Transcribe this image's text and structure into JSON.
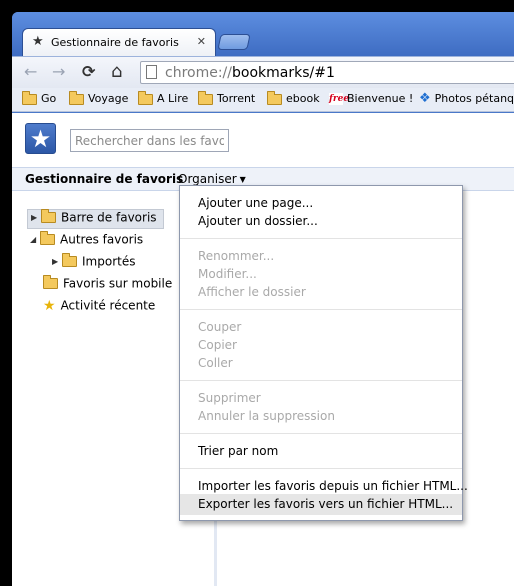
{
  "tab": {
    "title": "Gestionnaire de favoris",
    "close": "✕"
  },
  "toolbar": {
    "back": "←",
    "forward": "→",
    "reload": "⟳",
    "home": "⌂",
    "url_scheme": "chrome://",
    "url_rest": "bookmarks/#1"
  },
  "bookmarks_bar": [
    {
      "label": "Go",
      "icon": "folder-icon"
    },
    {
      "label": "Voyage",
      "icon": "folder-icon"
    },
    {
      "label": "A Lire",
      "icon": "folder-icon"
    },
    {
      "label": "Torrent",
      "icon": "folder-icon"
    },
    {
      "label": "ebook",
      "icon": "folder-icon"
    },
    {
      "label": "Bienvenue !",
      "icon": "free-icon",
      "icon_text": "free"
    },
    {
      "label": "Photos pétanque",
      "icon": "dropbox-icon"
    }
  ],
  "search": {
    "placeholder": "Rechercher dans les favor"
  },
  "header": {
    "title": "Gestionnaire de favoris",
    "organise": "Organiser"
  },
  "tree": [
    {
      "label": "Barre de favoris",
      "arrow": "▶",
      "icon": "folder-icon",
      "selected": true
    },
    {
      "label": "Autres favoris",
      "arrow": "◢",
      "icon": "folder-open-icon"
    },
    {
      "label": "Importés",
      "arrow": "▶",
      "icon": "folder-icon"
    },
    {
      "label": "Favoris sur mobile",
      "icon": "folder-icon"
    },
    {
      "label": "Activité récente",
      "icon": "star-icon"
    }
  ],
  "menu": {
    "add_page": "Ajouter une page...",
    "add_folder": "Ajouter un dossier...",
    "rename": "Renommer...",
    "edit": "Modifier...",
    "show_folder": "Afficher le dossier",
    "cut": "Couper",
    "copy": "Copier",
    "paste": "Coller",
    "delete": "Supprimer",
    "undo_delete": "Annuler la suppression",
    "sort": "Trier par nom",
    "import": "Importer les favoris depuis un fichier HTML...",
    "export": "Exporter les favoris vers un fichier HTML..."
  },
  "colors": {
    "chrome_frame": "#4a78c9",
    "menu_highlight": "#e6e6e6",
    "disabled_text": "#a9a9a9"
  }
}
